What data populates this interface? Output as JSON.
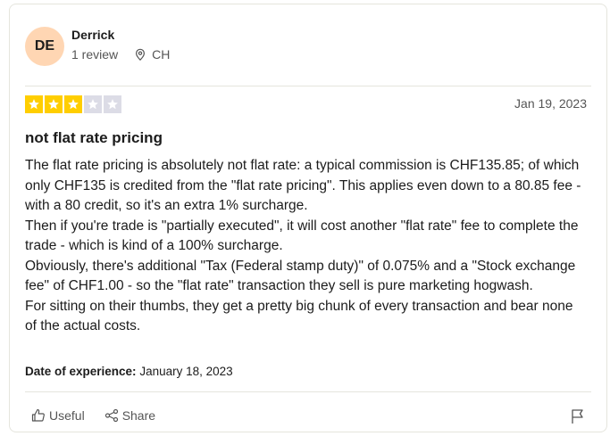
{
  "reviewer": {
    "initials": "DE",
    "name": "Derrick",
    "review_count": "1 review",
    "country": "CH"
  },
  "rating": {
    "value": 3,
    "max": 5,
    "filled_color": "#ffce00",
    "empty_color": "#dcdce6"
  },
  "review": {
    "date": "Jan 19, 2023",
    "title": "not flat rate pricing",
    "paragraphs": [
      "The flat rate pricing is absolutely not flat rate: a typical commission is CHF135.85; of which only CHF135 is credited from the \"flat rate pricing\". This applies even down to a 80.85 fee - with a 80 credit, so it's an extra 1% surcharge.",
      "Then if you're trade is \"partially executed\", it will cost another \"flat rate\" fee to complete the trade - which is kind of a 100% surcharge.",
      "Obviously, there's additional \"Tax (Federal stamp duty)\" of 0.075% and a \"Stock exchange fee\" of CHF1.00 - so the \"flat rate\" transaction they sell is pure marketing hogwash.",
      "For sitting on their thumbs, they get a pretty big chunk of every transaction and bear none of the actual costs."
    ],
    "experience_label": "Date of experience:",
    "experience_date": "January 18, 2023"
  },
  "actions": {
    "useful_label": "Useful",
    "share_label": "Share",
    "useful_icon": "thumbs-up-icon",
    "share_icon": "share-icon",
    "flag_icon": "flag-icon"
  }
}
